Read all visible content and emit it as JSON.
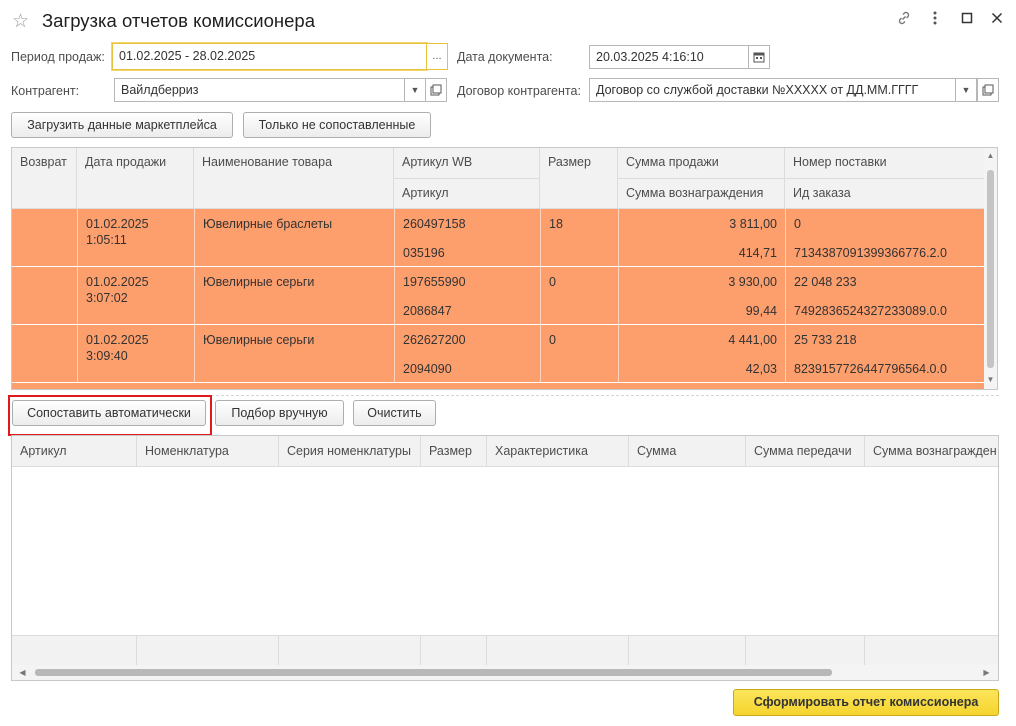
{
  "window": {
    "title": "Загрузка отчетов комиссионера",
    "link_icon": "link-icon",
    "more_icon": "more-icon",
    "maximize_icon": "maximize-icon",
    "close_icon": "close-icon",
    "star_icon": "star-icon"
  },
  "form": {
    "period_label": "Период продаж:",
    "period_value": "01.02.2025 - 28.02.2025",
    "period_btn": "...",
    "doc_date_label": "Дата документа:",
    "doc_date_value": "20.03.2025  4:16:10",
    "counterparty_label": "Контрагент:",
    "counterparty_value": "Вайлдберриз",
    "contract_label": "Договор контрагента:",
    "contract_value": "Договор со службой доставки №XXXXX от ДД.ММ.ГГГГ"
  },
  "toolbar1": {
    "load_label": "Загрузить данные маркетплейса",
    "unmatched_label": "Только не сопоставленные"
  },
  "table1": {
    "headers": {
      "return": "Возврат",
      "sale_date": "Дата продажи",
      "product_name": "Наименование товара",
      "article_wb": "Артикул WB",
      "article": "Артикул",
      "size": "Размер",
      "sale_sum": "Сумма продажи",
      "reward_sum": "Сумма вознаграждения",
      "supply_no": "Номер поставки",
      "order_id": "Ид заказа"
    },
    "rows": [
      {
        "date": "01.02.2025",
        "time": "1:05:11",
        "name": "Ювелирные браслеты",
        "article_wb": "260497158",
        "article": "035196",
        "size": "18",
        "sale_sum": "3 811,00",
        "reward_sum": "414,71",
        "supply_no": "0",
        "order_id": "7134387091399366776.2.0"
      },
      {
        "date": "01.02.2025",
        "time": "3:07:02",
        "name": "Ювелирные серьги",
        "article_wb": "197655990",
        "article": "2086847",
        "size": "0",
        "sale_sum": "3 930,00",
        "reward_sum": "99,44",
        "supply_no": "22 048 233",
        "order_id": "7492836524327233089.0.0"
      },
      {
        "date": "01.02.2025",
        "time": "3:09:40",
        "name": "Ювелирные серьги",
        "article_wb": "262627200",
        "article": "2094090",
        "size": "0",
        "sale_sum": "4 441,00",
        "reward_sum": "42,03",
        "supply_no": "25 733 218",
        "order_id": "8239157726447796564.0.0"
      }
    ],
    "row_color": "#fd9e6d"
  },
  "toolbar2": {
    "auto_match_label": "Сопоставить автоматически",
    "manual_label": "Подбор вручную",
    "clear_label": "Очистить"
  },
  "table2": {
    "headers": [
      "Артикул",
      "Номенклатура",
      "Серия номенклатуры",
      "Размер",
      "Характеристика",
      "Сумма",
      "Сумма передачи",
      "Сумма вознагражден"
    ]
  },
  "footer": {
    "generate_label": "Сформировать отчет комиссионера"
  },
  "colors": {
    "accent_yellow": "#f5d42d",
    "highlight_red": "#e01a1a"
  }
}
